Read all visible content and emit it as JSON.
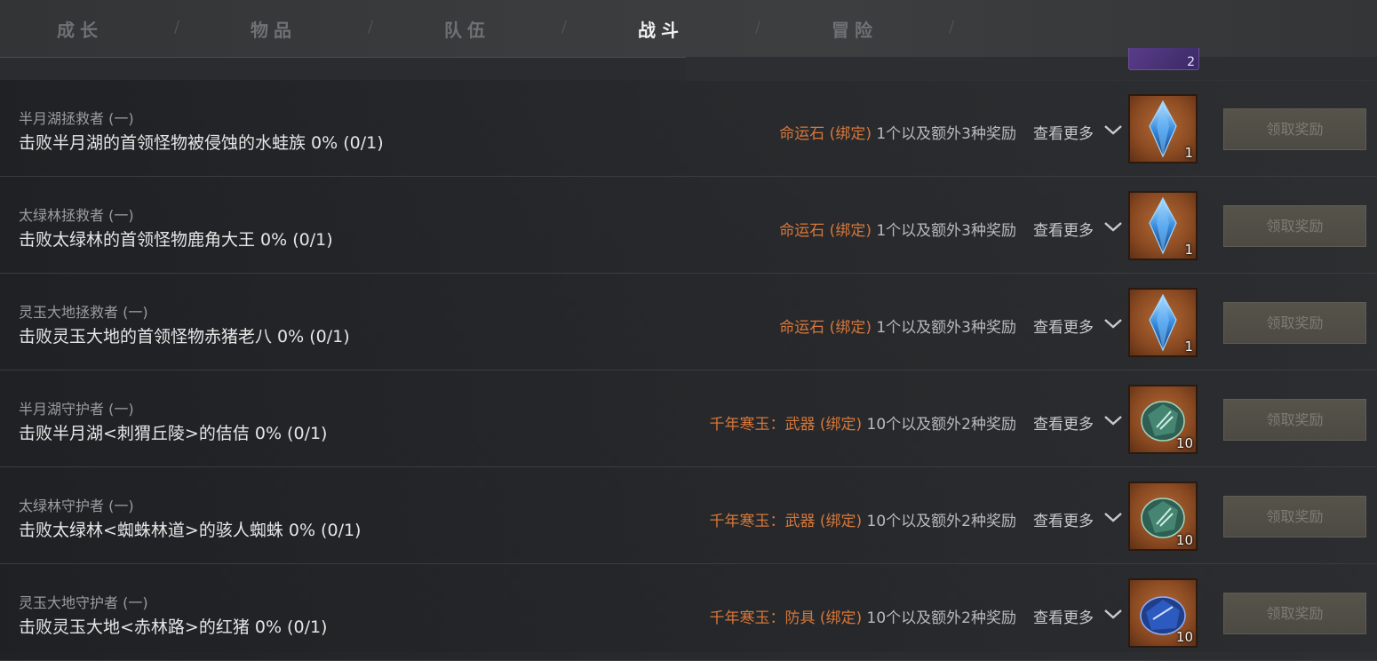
{
  "tabs": [
    {
      "label": "成长",
      "active": false
    },
    {
      "label": "物品",
      "active": false
    },
    {
      "label": "队伍",
      "active": false
    },
    {
      "label": "战斗",
      "active": true
    },
    {
      "label": "冒险",
      "active": false
    }
  ],
  "peek_item": {
    "count": "2"
  },
  "more_label": "查看更多",
  "claim_label": "领取奖励",
  "colors": {
    "reward_name": "#d7773a",
    "claim_disabled": "#7e7b72"
  },
  "rows": [
    {
      "title": "半月湖拯救者 (一)",
      "desc": "击败半月湖的首领怪物被侵蚀的水蛙族 0% (0/1)",
      "reward_name": "命运石 (绑定)",
      "reward_rest": " 1个以及额外3种奖励",
      "item_icon": "fate-stone-icon",
      "item_count": "1"
    },
    {
      "title": "太绿林拯救者 (一)",
      "desc": "击败太绿林的首领怪物鹿角大王 0% (0/1)",
      "reward_name": "命运石 (绑定)",
      "reward_rest": " 1个以及额外3种奖励",
      "item_icon": "fate-stone-icon",
      "item_count": "1"
    },
    {
      "title": "灵玉大地拯救者 (一)",
      "desc": "击败灵玉大地的首领怪物赤猪老八 0% (0/1)",
      "reward_name": "命运石 (绑定)",
      "reward_rest": " 1个以及额外3种奖励",
      "item_icon": "fate-stone-icon",
      "item_count": "1"
    },
    {
      "title": "半月湖守护者 (一)",
      "desc": "击败半月湖<刺猬丘陵>的佶佶 0% (0/1)",
      "reward_name": "千年寒玉：武器 (绑定)",
      "reward_rest": " 10个以及额外2种奖励",
      "item_icon": "weapon-jade-icon",
      "item_count": "10"
    },
    {
      "title": "太绿林守护者 (一)",
      "desc": "击败太绿林<蜘蛛林道>的骇人蜘蛛 0% (0/1)",
      "reward_name": "千年寒玉：武器 (绑定)",
      "reward_rest": " 10个以及额外2种奖励",
      "item_icon": "weapon-jade-icon",
      "item_count": "10"
    },
    {
      "title": "灵玉大地守护者 (一)",
      "desc": "击败灵玉大地<赤林路>的红猪 0% (0/1)",
      "reward_name": "千年寒玉：防具 (绑定)",
      "reward_rest": " 10个以及额外2种奖励",
      "item_icon": "armor-jade-icon",
      "item_count": "10"
    }
  ]
}
